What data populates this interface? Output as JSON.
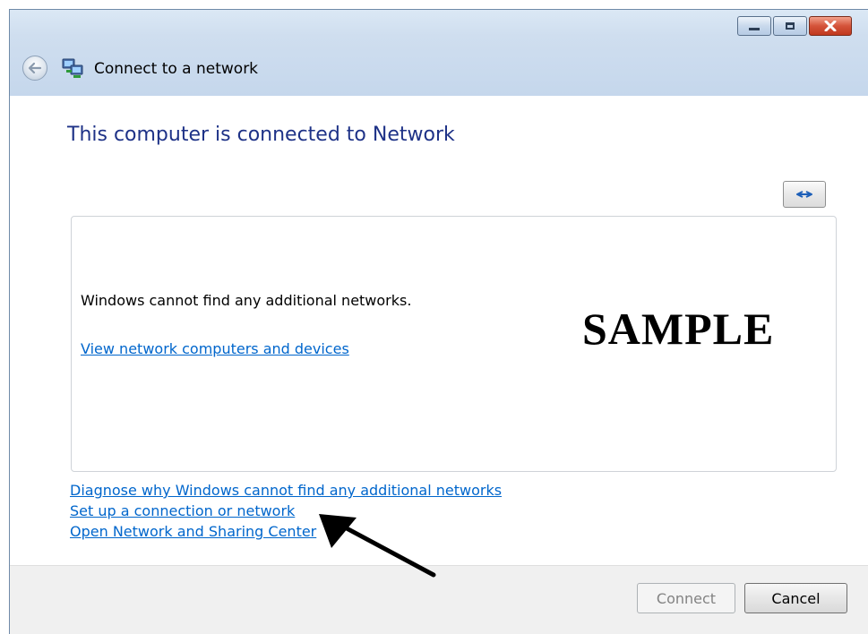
{
  "window": {
    "title": "Connect to a network",
    "controls": {
      "minimize": "minimize",
      "maximize": "maximize",
      "close": "close"
    }
  },
  "main": {
    "heading": "This computer is connected to Network",
    "status_message": "Windows cannot find any additional networks.",
    "view_link": "View network computers and devices",
    "watermark": "SAMPLE"
  },
  "links": [
    "Diagnose why Windows cannot find any additional networks",
    "Set up a connection or network",
    "Open Network and Sharing Center"
  ],
  "footer": {
    "connect_label": "Connect",
    "cancel_label": "Cancel"
  },
  "icons": {
    "back": "back-arrow-icon",
    "network": "network-icon",
    "refresh": "refresh-icon",
    "pointer": "annotation-arrow-icon"
  },
  "colors": {
    "heading": "#1e3287",
    "link": "#0066cc",
    "close_button": "#c0391e"
  }
}
